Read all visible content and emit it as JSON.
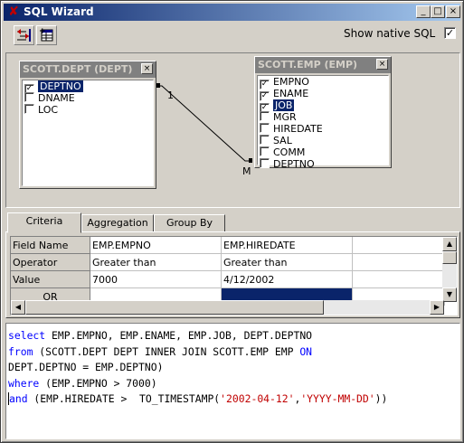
{
  "window": {
    "title": "SQL Wizard",
    "minimize": "_",
    "maximize": "□",
    "close": "×"
  },
  "toolbar": {
    "btn1_icon": "arrange-icon",
    "btn2_icon": "add-table-icon",
    "native_label": "Show native SQL",
    "native_checked": true
  },
  "diagram": {
    "tables": [
      {
        "title": "SCOTT.DEPT (DEPT)",
        "close": "×",
        "fields": [
          {
            "name": "DEPTNO",
            "checked": true,
            "selected": true
          },
          {
            "name": "DNAME",
            "checked": false,
            "selected": false
          },
          {
            "name": "LOC",
            "checked": false,
            "selected": false
          }
        ]
      },
      {
        "title": "SCOTT.EMP (EMP)",
        "close": "×",
        "fields": [
          {
            "name": "EMPNO",
            "checked": true,
            "selected": false
          },
          {
            "name": "ENAME",
            "checked": true,
            "selected": false
          },
          {
            "name": "JOB",
            "checked": true,
            "selected": true
          },
          {
            "name": "MGR",
            "checked": false,
            "selected": false
          },
          {
            "name": "HIREDATE",
            "checked": false,
            "selected": false
          },
          {
            "name": "SAL",
            "checked": false,
            "selected": false
          },
          {
            "name": "COMM",
            "checked": false,
            "selected": false
          },
          {
            "name": "DEPTNO",
            "checked": false,
            "selected": false
          }
        ]
      }
    ],
    "join": {
      "left_label": "1",
      "right_label": "M"
    }
  },
  "tabs": [
    {
      "label": "Criteria",
      "active": true
    },
    {
      "label": "Aggregation",
      "active": false
    },
    {
      "label": "Group By",
      "active": false
    }
  ],
  "grid": {
    "rows": [
      {
        "header": "Field Name",
        "cells": [
          "EMP.EMPNO",
          "EMP.HIREDATE",
          ""
        ]
      },
      {
        "header": "Operator",
        "cells": [
          "Greater than",
          "Greater than",
          ""
        ]
      },
      {
        "header": "Value",
        "cells": [
          "7000",
          "4/12/2002",
          ""
        ]
      },
      {
        "header": "OR",
        "cells": [
          "",
          "",
          ""
        ]
      }
    ]
  },
  "sql": {
    "lines": [
      [
        {
          "t": "select",
          "c": "kw"
        },
        {
          "t": " EMP.EMPNO, EMP.ENAME, EMP.JOB, DEPT.DEPTNO",
          "c": ""
        }
      ],
      [
        {
          "t": "from",
          "c": "kw"
        },
        {
          "t": " (SCOTT.DEPT DEPT INNER JOIN SCOTT.EMP EMP ",
          "c": ""
        },
        {
          "t": "ON",
          "c": "kw"
        }
      ],
      [
        {
          "t": "DEPT.DEPTNO = EMP.DEPTNO)",
          "c": ""
        }
      ],
      [
        {
          "t": "where",
          "c": "kw"
        },
        {
          "t": " (EMP.EMPNO > 7000)",
          "c": ""
        }
      ],
      [
        {
          "t": "and",
          "c": "kw"
        },
        {
          "t": " (EMP.HIREDATE >  TO_TIMESTAMP(",
          "c": ""
        },
        {
          "t": "'2002-04-12'",
          "c": "str"
        },
        {
          "t": ",",
          "c": ""
        },
        {
          "t": "'YYYY-MM-DD'",
          "c": "str"
        },
        {
          "t": "))",
          "c": ""
        }
      ]
    ]
  }
}
